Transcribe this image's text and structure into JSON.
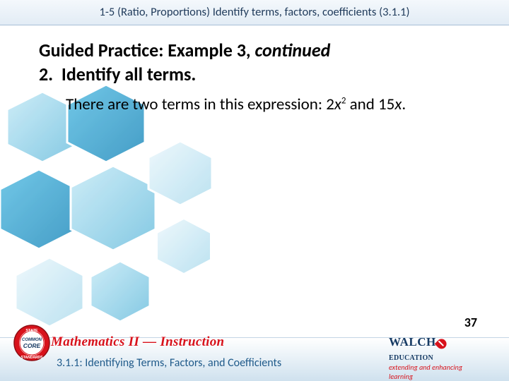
{
  "topbar": {
    "text": "1-5 (Ratio, Proportions) Identify terms, factors, coefficients (3.1.1)"
  },
  "heading": {
    "prefix": "Guided Practice: Example 3, ",
    "continued": "continued",
    "line2_number": "2.",
    "line2_text": "Identify all terms."
  },
  "body": {
    "intro": "There are two terms in this expression: ",
    "term1_coef": "2",
    "term1_var": "x",
    "term1_exp": "2",
    "mid": " and ",
    "term2_coef": "15",
    "term2_var": "x",
    "period": "."
  },
  "page_number": "37",
  "footer": {
    "brand": "Mathematics II — Instruction",
    "subtitle": "3.1.1: Identifying Terms, Factors, and Coefficients",
    "publisher": "WALCH",
    "publisher_sub": "EDUCATION",
    "tagline": "extending and enhancing learning",
    "seal_top": "STATE",
    "seal_mid": "COMMON",
    "seal_core": "CORE",
    "seal_bottom": "STANDARDS"
  }
}
